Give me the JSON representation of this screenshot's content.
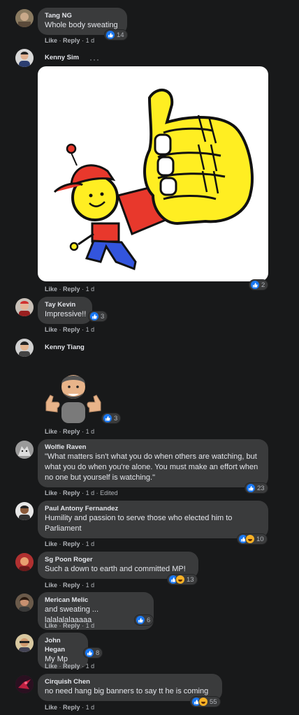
{
  "actions": {
    "like": "Like",
    "reply": "Reply",
    "sep": "·",
    "edited": "Edited"
  },
  "comments": [
    {
      "name": "Tang NG",
      "text": "Whole body sweating",
      "time": "1 d",
      "reactions": "14"
    },
    {
      "name": "Kenny Sim",
      "more": "···",
      "time": "1 d",
      "reactions": "2"
    },
    {
      "name": "Tay Kevin",
      "text": "Impressive!!",
      "time": "1 d",
      "reactions": "3"
    },
    {
      "name": "Kenny Tiang",
      "time": "1 d",
      "reactions": "3"
    },
    {
      "name": "Wolfie Raven",
      "text": "\"What matters isn't what you do when others are watching, but what you do when you're alone. You must make an effort when no one but yourself is watching.\"",
      "time": "1 d",
      "reactions": "23"
    },
    {
      "name": "Paul Antony Fernandez",
      "text": "Humility and passion to serve those who elected him to Parliament",
      "time": "1 d",
      "reactions": "10"
    },
    {
      "name": "Sg Poon Roger",
      "text": "Such a down to earth and committed MP!",
      "time": "1 d",
      "reactions": "13"
    },
    {
      "name": "Merican Melic",
      "text": "and sweating ... lalalalalaaaaa",
      "time": "1 d",
      "reactions": "6"
    },
    {
      "name": "John Hegan",
      "text": "My Mp",
      "time": "1 d",
      "reactions": "8"
    },
    {
      "name": "Cirquish Chen",
      "text": "no need hang big banners to say tt he is coming",
      "time": "1 d",
      "reactions": "55"
    }
  ]
}
